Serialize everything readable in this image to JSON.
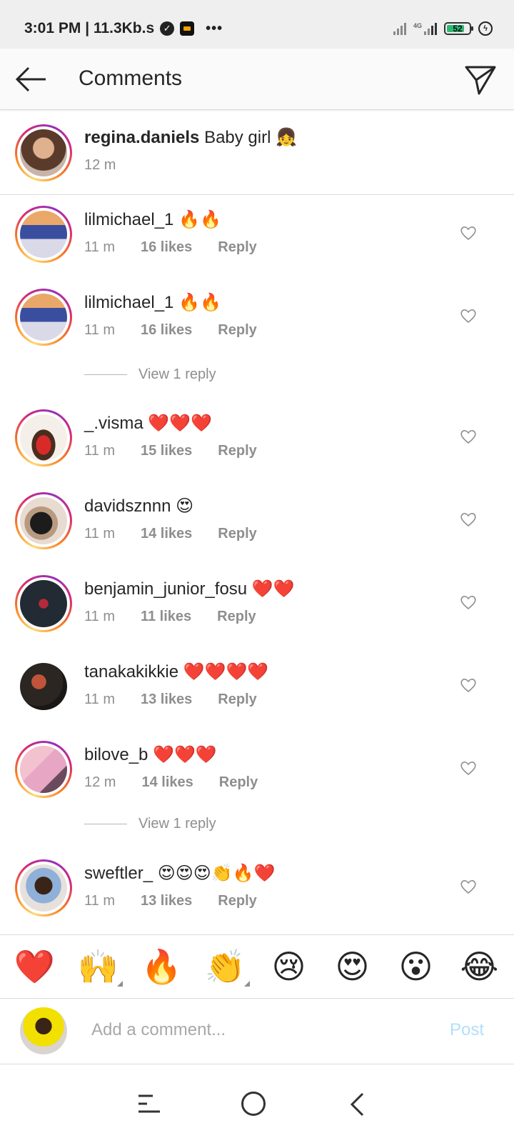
{
  "status_bar": {
    "time": "3:01 PM | 11.3Kb.s",
    "dots": "•••",
    "network_label": "4G",
    "battery": "52"
  },
  "header": {
    "title": "Comments"
  },
  "caption": {
    "username": "regina.daniels",
    "text": "Baby girl 👧",
    "time": "12 m"
  },
  "comments": [
    {
      "username": "lilmichael_1",
      "text": "🔥🔥",
      "time": "11 m",
      "likes": "16 likes",
      "reply": "Reply"
    },
    {
      "username": "lilmichael_1",
      "text": "🔥🔥",
      "time": "11 m",
      "likes": "16 likes",
      "reply": "Reply"
    },
    {
      "username": "_.visma",
      "text": "❤️❤️❤️",
      "time": "11 m",
      "likes": "15 likes",
      "reply": "Reply"
    },
    {
      "username": "davidsznnn",
      "text": "😍",
      "time": "11 m",
      "likes": "14 likes",
      "reply": "Reply"
    },
    {
      "username": "benjamin_junior_fosu",
      "text": "❤️❤️",
      "time": "11 m",
      "likes": "11 likes",
      "reply": "Reply"
    },
    {
      "username": "tanakakikkie",
      "text": "❤️❤️❤️❤️",
      "time": "11 m",
      "likes": "13 likes",
      "reply": "Reply"
    },
    {
      "username": "bilove_b",
      "text": "❤️❤️❤️",
      "time": "12 m",
      "likes": "14 likes",
      "reply": "Reply"
    },
    {
      "username": "sweftler_",
      "text": "😍😍😍👏🔥❤️",
      "time": "11 m",
      "likes": "13 likes",
      "reply": "Reply"
    }
  ],
  "view_replies": [
    "View 1 reply",
    "View 1 reply"
  ],
  "emoji_bar": [
    "❤️",
    "🙌",
    "🔥",
    "👏",
    "😢",
    "😍",
    "😮",
    "😂"
  ],
  "composer": {
    "placeholder": "Add a comment...",
    "post_label": "Post"
  },
  "colors": {
    "accent_post_disabled": "#b2dffc",
    "secondary_text": "#8e8e8e",
    "primary_text": "#262626"
  }
}
